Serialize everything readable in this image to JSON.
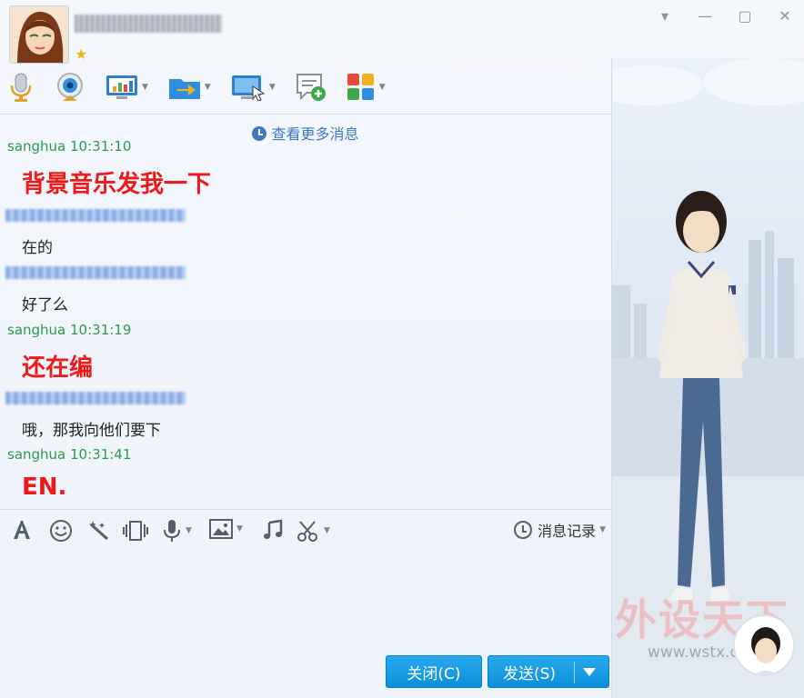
{
  "header": {
    "contact_name": "██████████",
    "window_controls": [
      "▾",
      "—",
      "▢",
      "✕"
    ]
  },
  "toolbar": {
    "items": [
      "mic-icon",
      "webcam-icon",
      "screen-share-icon",
      "file-transfer-icon",
      "remote-desktop-icon",
      "create-discussion-icon",
      "apps-icon"
    ]
  },
  "chat": {
    "more_messages_label": "查看更多消息",
    "messages": [
      {
        "sender": "sanghua 10:31:10",
        "text": "背景音乐发我一下",
        "style": "big"
      },
      {
        "sender": "",
        "text": "在的",
        "style": "normal"
      },
      {
        "sender": "",
        "text": "好了么",
        "style": "normal"
      },
      {
        "sender": "sanghua 10:31:19",
        "text": "还在编",
        "style": "big"
      },
      {
        "sender": "",
        "text": "哦，那我向他们要下",
        "style": "normal"
      },
      {
        "sender": "sanghua 10:31:41",
        "text": "EN.",
        "style": "big"
      }
    ]
  },
  "input_toolbar": {
    "history_label": "消息记录"
  },
  "buttons": {
    "close_label": "关闭(C)",
    "send_label": "发送(S)"
  },
  "watermark": {
    "text": "外设天下",
    "url": "www.wstx.com"
  },
  "colors": {
    "sender_green": "#2a9b4b",
    "message_red": "#ee1a1a",
    "button_blue": "#0b8fd8",
    "link_blue": "#3e79c4"
  }
}
